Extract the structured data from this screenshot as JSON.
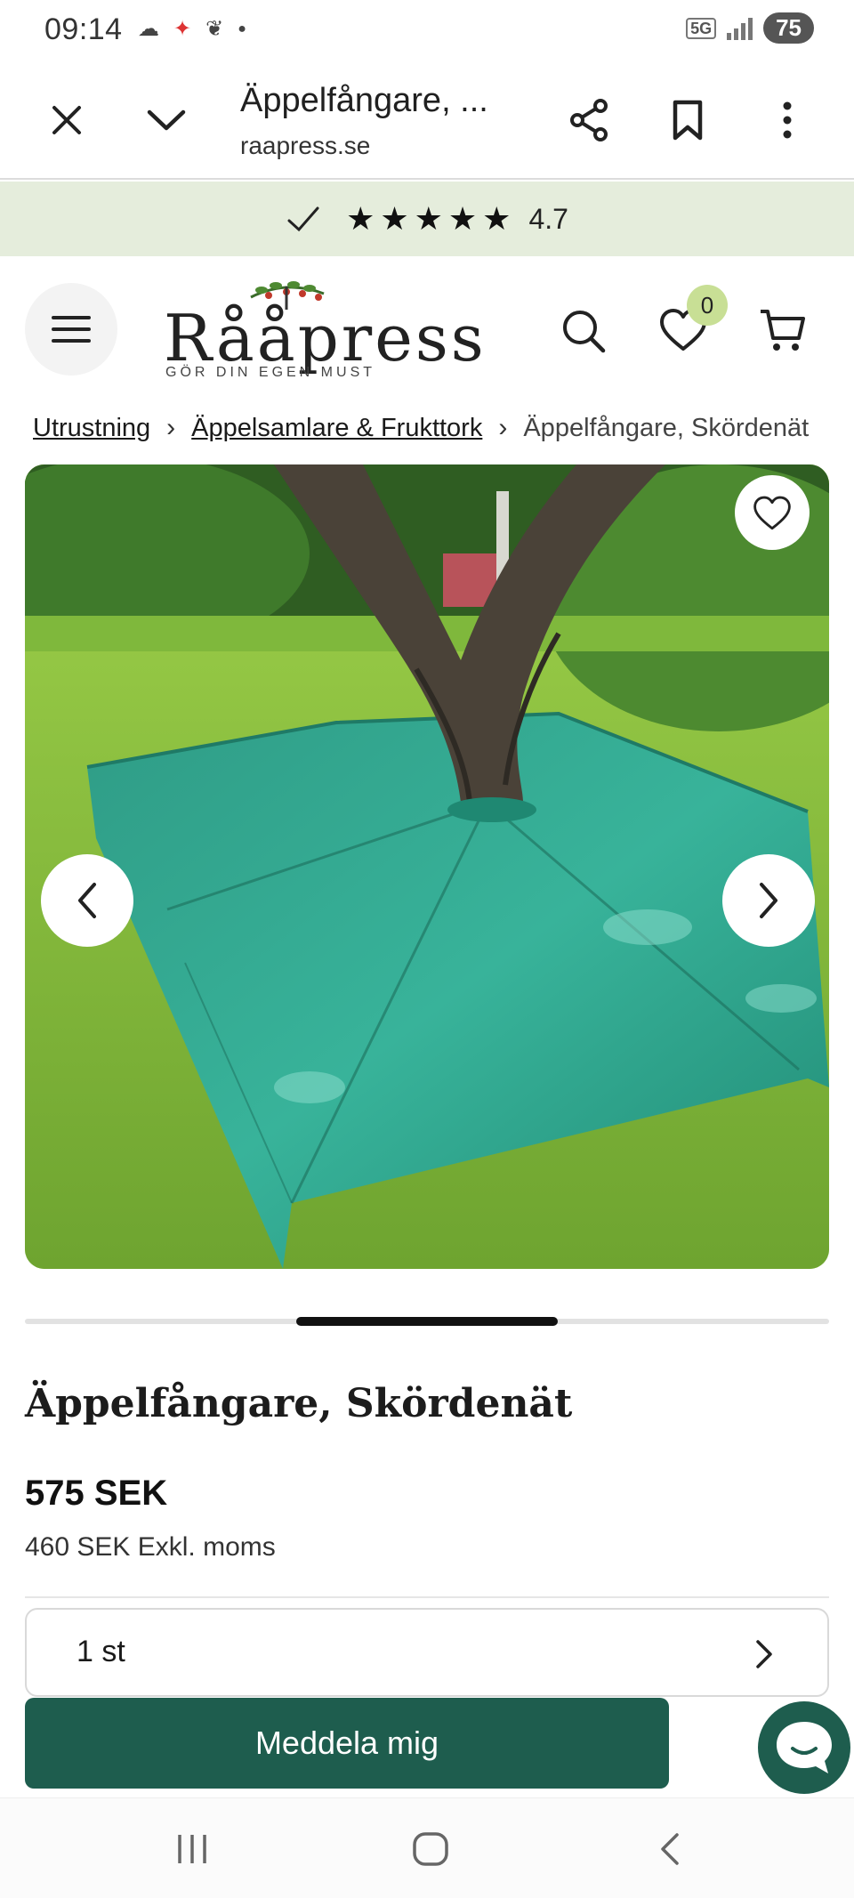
{
  "status_bar": {
    "time": "09:14",
    "network": "5G",
    "battery": "75",
    "icons": [
      "cloud-icon",
      "app-icon",
      "leaf-icon",
      "dot-icon"
    ]
  },
  "browser": {
    "title": "Äppelfångare, ...",
    "url": "raapress.se",
    "icons": [
      "close-icon",
      "chevron-down-icon",
      "share-icon",
      "bookmark-icon",
      "more-vert-icon"
    ]
  },
  "rating": {
    "stars": "★★★★★",
    "score": "4.7"
  },
  "header": {
    "logo_text": "Rååpress",
    "logo_tagline": "GÖR DIN EGEN MUST",
    "wishlist_count": "0"
  },
  "breadcrumb": {
    "items": [
      "Utrustning",
      "Äppelsamlare & Frukttork"
    ],
    "current": "Äppelfångare, Skördenät"
  },
  "gallery": {
    "slide_fraction": 0.33
  },
  "product": {
    "title": "Äppelfångare, Skördenät",
    "price": "575 SEK",
    "price_ex_vat": "460 SEK Exkl. moms",
    "quantity": "1 st",
    "notify_label": "Meddela mig"
  },
  "colors": {
    "brand_green": "#1e5d4e",
    "rating_band": "#e5eddc",
    "badge": "#c8df95"
  }
}
